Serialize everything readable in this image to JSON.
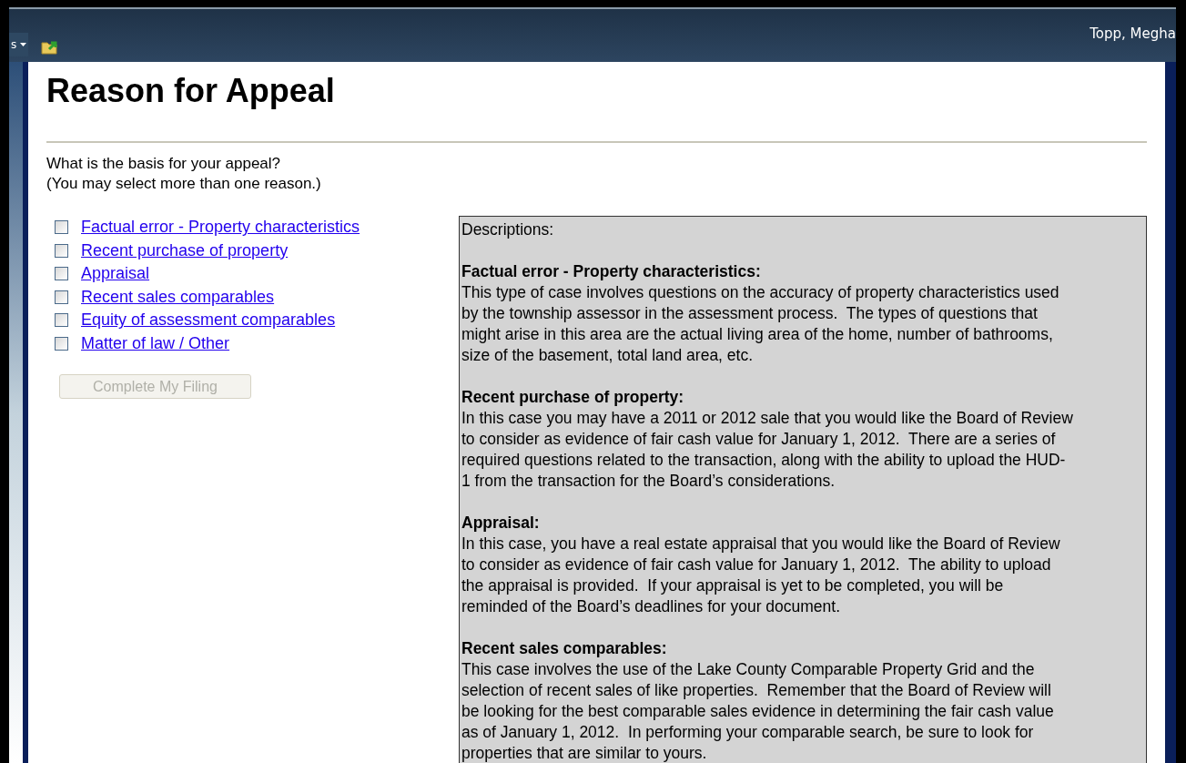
{
  "top_bar": {
    "menu_fragment": "s",
    "user_name": "Topp, Megha"
  },
  "page_title": "Reason for Appeal",
  "prompt": [
    "What is the basis for your appeal?",
    "(You may select more than one reason.)"
  ],
  "reasons": [
    {
      "label": "Factual error - Property characteristics",
      "checked": false
    },
    {
      "label": "Recent purchase of property",
      "checked": false
    },
    {
      "label": "Appraisal",
      "checked": false
    },
    {
      "label": "Recent sales comparables",
      "checked": false
    },
    {
      "label": "Equity of assessment comparables",
      "checked": false
    },
    {
      "label": "Matter of law / Other",
      "checked": false
    }
  ],
  "complete_button": {
    "label": "Complete My Filing",
    "disabled": true
  },
  "descriptions": {
    "title": "Descriptions:",
    "sections": [
      {
        "heading": "Factual error - Property characteristics:",
        "lines": [
          "This type of case involves questions on the accuracy of property characteristics used",
          "by the township assessor in the assessment process.  The types of questions that",
          "might arise in this area are the actual living area of the home, number of bathrooms,",
          "size of the basement, total land area, etc."
        ]
      },
      {
        "heading": "Recent purchase of property:",
        "lines": [
          "In this case you may have a 2011 or 2012 sale that you would like the Board of Review",
          "to consider as evidence of fair cash value for January 1, 2012.  There are a series of",
          "required questions related to the transaction, along with the ability to upload the HUD-",
          "1 from the transaction for the Board’s considerations."
        ]
      },
      {
        "heading": "Appraisal:",
        "lines": [
          "In this case, you have a real estate appraisal that you would like the Board of Review",
          "to consider as evidence of fair cash value for January 1, 2012.  The ability to upload",
          "the appraisal is provided.  If your appraisal is yet to be completed, you will be",
          "reminded of the Board’s deadlines for your document."
        ]
      },
      {
        "heading": "Recent sales comparables:",
        "lines": [
          "This case involves the use of the Lake County Comparable Property Grid and the",
          "selection of recent sales of like properties.  Remember that the Board of Review will",
          "be looking for the best comparable sales evidence in determining the fair cash value",
          "as of January 1, 2012.  In performing your comparable search, be sure to look for",
          "properties that are similar to yours."
        ]
      }
    ]
  }
}
